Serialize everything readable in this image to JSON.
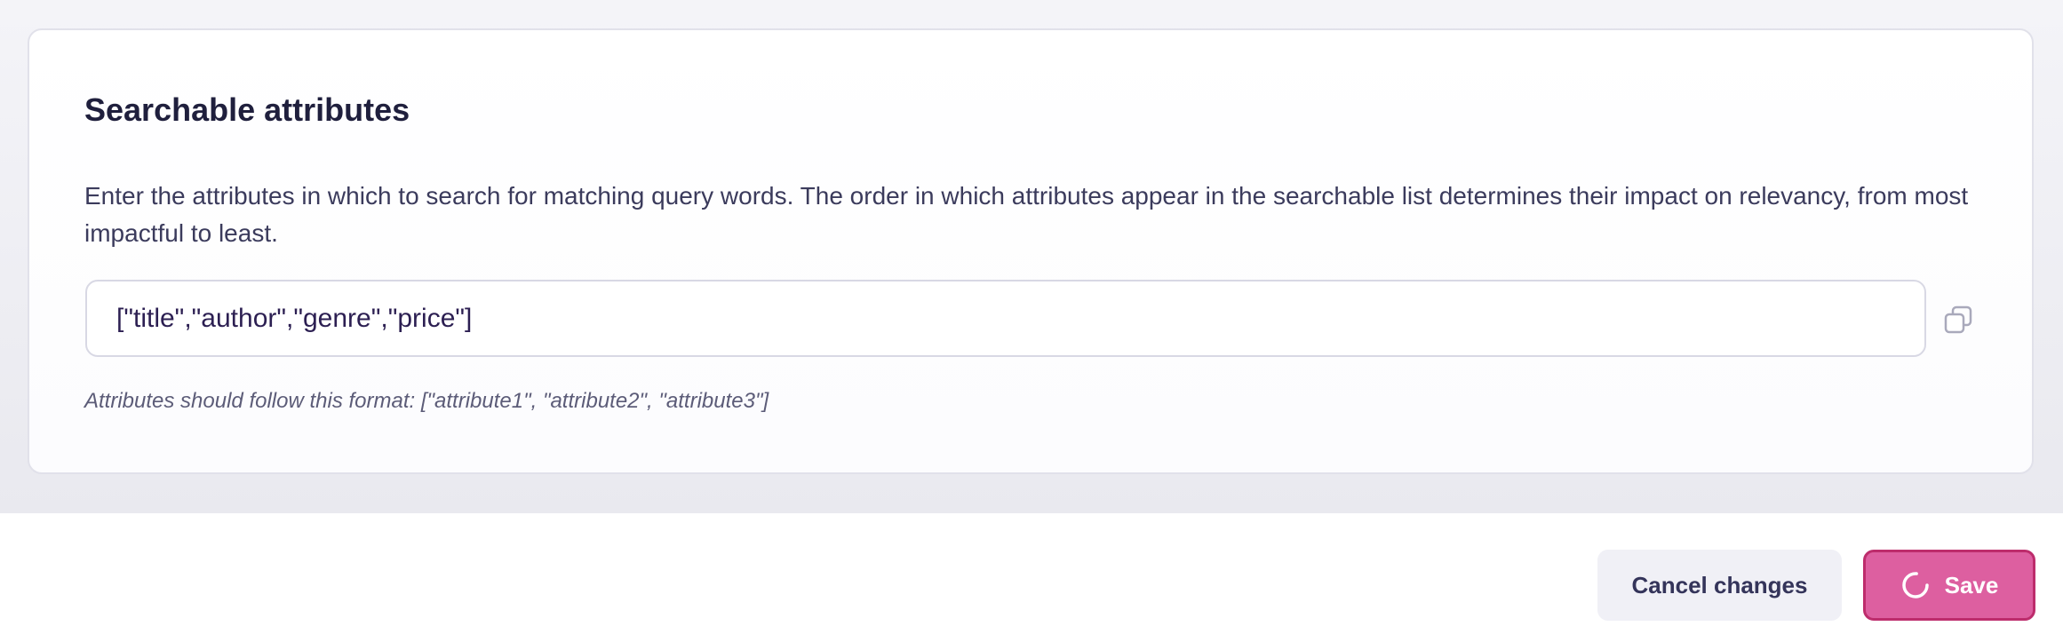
{
  "section": {
    "title": "Searchable attributes",
    "description": "Enter the attributes in which to search for matching query words. The order in which attributes appear in the searchable list determines their impact on relevancy, from most impactful to least.",
    "input_value": "[\"title\",\"author\",\"genre\",\"price\"]",
    "hint": "Attributes should follow this format: [\"attribute1\", \"attribute2\", \"attribute3\"]",
    "copy_icon": "copy-icon"
  },
  "footer": {
    "cancel_label": "Cancel changes",
    "save_label": "Save",
    "save_icon": "loading-spinner-icon"
  },
  "colors": {
    "primary": "#dd5fa0",
    "primary_border": "#bd2c6c",
    "text_dark": "#1f1f3d",
    "text_body": "#3b3b5c",
    "muted": "#5c5c78"
  }
}
